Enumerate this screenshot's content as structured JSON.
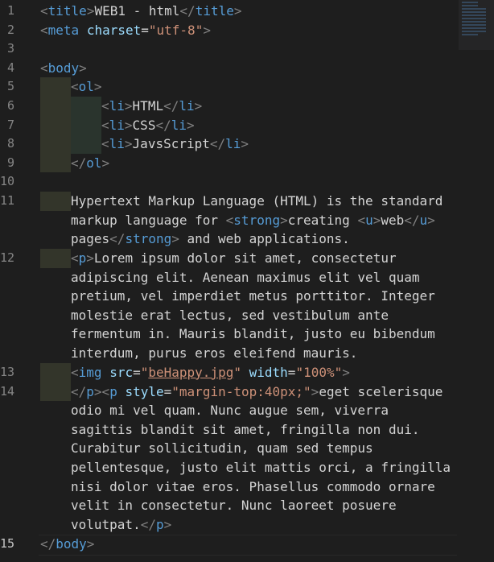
{
  "line_numbers": [
    "1",
    "2",
    "3",
    "4",
    "5",
    "6",
    "7",
    "8",
    "9",
    "10",
    "11",
    "12",
    "13",
    "14",
    "15"
  ],
  "lines": {
    "l1": {
      "open": "<",
      "tag": "title",
      "close": ">",
      "text": "WEB1 - html",
      "end_open": "</",
      "end_tag": "title",
      "end_close": ">"
    },
    "l2": {
      "open": "<",
      "tag": "meta",
      "attr": "charset",
      "eq": "=",
      "val": "\"utf-8\"",
      "close": ">"
    },
    "l4": {
      "open": "<",
      "tag": "body",
      "close": ">"
    },
    "l5": {
      "open": "<",
      "tag": "ol",
      "close": ">"
    },
    "l6": {
      "open": "<",
      "tag": "li",
      "close": ">",
      "text": "HTML",
      "end_open": "</",
      "end_tag": "li",
      "end_close": ">"
    },
    "l7": {
      "open": "<",
      "tag": "li",
      "close": ">",
      "text": "CSS",
      "end_open": "</",
      "end_tag": "li",
      "end_close": ">"
    },
    "l8": {
      "open": "<",
      "tag": "li",
      "close": ">",
      "text": "JavsScript",
      "end_open": "</",
      "end_tag": "li",
      "end_close": ">"
    },
    "l9": {
      "open": "</",
      "tag": "ol",
      "close": ">"
    },
    "l11": {
      "t1": "Hypertext Markup Language (HTML) is the standard markup language for ",
      "strong_open": "<",
      "strong": "strong",
      "strong_close": ">",
      "t2": "creating ",
      "u_open": "<",
      "u": "u",
      "u_close": ">",
      "t3": "web",
      "u_end_open": "</",
      "u_end": "u",
      "u_end_close": ">",
      "t4": " pages",
      "strong_end_open": "</",
      "strong_end": "strong",
      "strong_end_close": ">",
      "t5": " and web applications."
    },
    "l12": {
      "open": "<",
      "tag": "p",
      "close": ">",
      "text": "Lorem ipsum dolor sit amet, consectetur adipiscing elit. Aenean maximus elit vel quam pretium, vel imperdiet metus porttitor. Integer molestie erat lectus, sed vestibulum ante fermentum in. Mauris blandit, justo eu bibendum interdum, purus eros eleifend mauris."
    },
    "l13": {
      "open": "<",
      "tag": "img",
      "attr1": "src",
      "eq1": "=",
      "q1": "\"",
      "val1": "beHappy.jpg",
      "q1e": "\"",
      "attr2": "width",
      "eq2": "=",
      "val2": "\"100%\"",
      "close": ">"
    },
    "l14": {
      "p_end_open": "</",
      "p_end": "p",
      "p_end_close": ">",
      "open": "<",
      "tag": "p",
      "attr": "style",
      "eq": "=",
      "val": "\"margin-top:40px;\"",
      "close": ">",
      "text": "eget scelerisque odio mi vel quam. Nunc augue sem, viverra sagittis blandit sit amet, fringilla non dui. Curabitur sollicitudin, quam sed tempus pellentesque, justo elit mattis orci, a fringilla nisi dolor vitae eros. Phasellus commodo ornare velit in consectetur. Nunc laoreet posuere volutpat.",
      "end_open": "</",
      "end_tag": "p",
      "end_close": ">"
    },
    "l15": {
      "open": "</",
      "tag": "body",
      "close": ">"
    }
  },
  "colors": {
    "background": "#1e1e1e",
    "tag": "#569cd6",
    "bracket": "#808080",
    "attribute": "#9cdcfe",
    "string": "#ce9178",
    "text": "#d4d4d4"
  }
}
